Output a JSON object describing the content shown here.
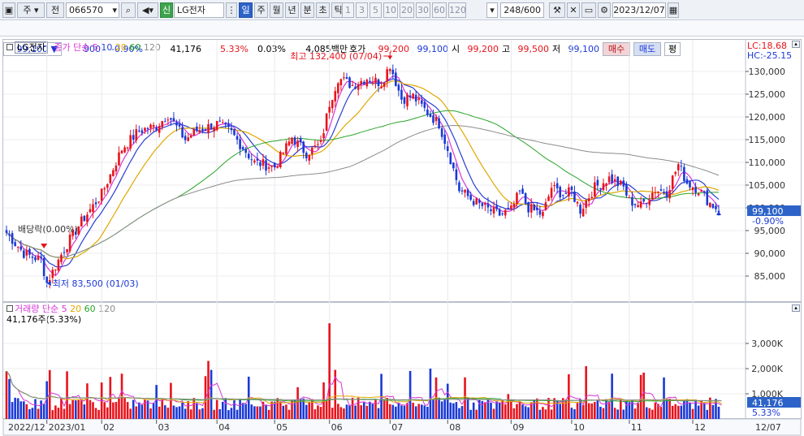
{
  "toolbar": {
    "market_label": "주",
    "exchange_label": "전",
    "stock_code": "066570",
    "stock_name": "LG전자",
    "stock_badge": "신",
    "period_buttons": [
      "일",
      "주",
      "월",
      "년",
      "분",
      "초",
      "틱"
    ],
    "interval_buttons": [
      "1",
      "3",
      "5",
      "10",
      "20",
      "30",
      "60",
      "120"
    ],
    "bar_count": "248/600",
    "date": "2023/12/07"
  },
  "info": {
    "price": "99,100",
    "change": "900",
    "change_pct": "-0.90%",
    "volume": "41,176",
    "volume_ratio": "5.33%",
    "turnover": "0.03%",
    "amount": "4,085백만",
    "ask_label": "호가",
    "ask": "99,200",
    "bid": "99,100",
    "open_label": "시",
    "open": "99,200",
    "high_label": "고",
    "high": "99,500",
    "low_label": "저",
    "low": "99,100",
    "buy_button": "매수",
    "sell_button": "매도",
    "eval_button": "평"
  },
  "legend": {
    "price_name": "LG전자",
    "ma_label": "종가 단순",
    "ma_periods": [
      "5",
      "10",
      "20",
      "60",
      "120"
    ],
    "lc": "LC:18.68",
    "hc": "HC:-25.15",
    "volume_label": "거래량 단순",
    "vol_ma_periods": [
      "5",
      "20",
      "60",
      "120"
    ],
    "volume_value": "41,176주(5.33%)"
  },
  "annotations": {
    "high": "최고 132,400 (07/04)",
    "low": "최저 83,500 (01/03)",
    "dividend": "배당락(0.00%)",
    "last_price": "99,100",
    "last_change": "-0.90%",
    "last_volume": "41,176",
    "last_volume_pct": "5.33%"
  },
  "colors": {
    "up": "#e8131c",
    "down": "#1a39d6",
    "ma5": "#d636d6",
    "ma10": "#2a3fd2",
    "ma20": "#e0a800",
    "ma60": "#2aa52a",
    "ma120": "#8c8c8c",
    "highlight": "#2d63c8"
  },
  "chart_data": {
    "type": "candlestick",
    "price_axis": {
      "min": 80000,
      "max": 135000,
      "ticks": [
        "85,000",
        "90,000",
        "95,000",
        "100,000",
        "105,000",
        "110,000",
        "115,000",
        "120,000",
        "125,000",
        "130,000"
      ],
      "tick_values": [
        85000,
        90000,
        95000,
        100000,
        105000,
        110000,
        115000,
        120000,
        125000,
        130000
      ]
    },
    "volume_axis": {
      "min": 0,
      "max": 4000000,
      "ticks": [
        "1,000K",
        "2,000K",
        "3,000K"
      ],
      "tick_values": [
        1000000,
        2000000,
        3000000
      ]
    },
    "x_axis": {
      "labels": [
        "2022/12",
        "2023/01",
        "02",
        "03",
        "04",
        "05",
        "06",
        "07",
        "08",
        "09",
        "10",
        "11",
        "12",
        "12/07"
      ],
      "label_index": [
        0,
        14,
        33,
        52,
        73,
        93,
        112,
        133,
        153,
        175,
        196,
        216,
        238,
        248
      ]
    },
    "bar_count": 248,
    "anchors": [
      [
        0,
        94500
      ],
      [
        6,
        90000
      ],
      [
        12,
        88500
      ],
      [
        14,
        83500
      ],
      [
        20,
        91000
      ],
      [
        26,
        97000
      ],
      [
        33,
        103000
      ],
      [
        40,
        113000
      ],
      [
        46,
        117000
      ],
      [
        52,
        118000
      ],
      [
        56,
        120500
      ],
      [
        62,
        115000
      ],
      [
        66,
        117000
      ],
      [
        73,
        118500
      ],
      [
        78,
        116500
      ],
      [
        86,
        110000
      ],
      [
        93,
        109000
      ],
      [
        99,
        115500
      ],
      [
        104,
        112000
      ],
      [
        109,
        114000
      ],
      [
        112,
        123000
      ],
      [
        115,
        128500
      ],
      [
        120,
        127000
      ],
      [
        125,
        128500
      ],
      [
        130,
        127500
      ],
      [
        133,
        131500
      ],
      [
        137,
        124000
      ],
      [
        141,
        124500
      ],
      [
        146,
        121000
      ],
      [
        150,
        118500
      ],
      [
        153,
        113000
      ],
      [
        157,
        104000
      ],
      [
        162,
        101500
      ],
      [
        166,
        100000
      ],
      [
        171,
        98500
      ],
      [
        175,
        99500
      ],
      [
        178,
        103500
      ],
      [
        181,
        100000
      ],
      [
        186,
        98500
      ],
      [
        189,
        104500
      ],
      [
        193,
        103000
      ],
      [
        196,
        103500
      ],
      [
        199,
        99500
      ],
      [
        204,
        104500
      ],
      [
        209,
        106500
      ],
      [
        214,
        104500
      ],
      [
        216,
        101500
      ],
      [
        220,
        100500
      ],
      [
        225,
        104000
      ],
      [
        229,
        103500
      ],
      [
        233,
        109500
      ],
      [
        236,
        105500
      ],
      [
        240,
        104000
      ],
      [
        244,
        101000
      ],
      [
        248,
        99100
      ]
    ],
    "series": [
      {
        "name": "5",
        "ma": 5
      },
      {
        "name": "10",
        "ma": 10
      },
      {
        "name": "20",
        "ma": 20
      },
      {
        "name": "60",
        "ma": 60
      },
      {
        "name": "120",
        "ma": 120
      }
    ]
  }
}
